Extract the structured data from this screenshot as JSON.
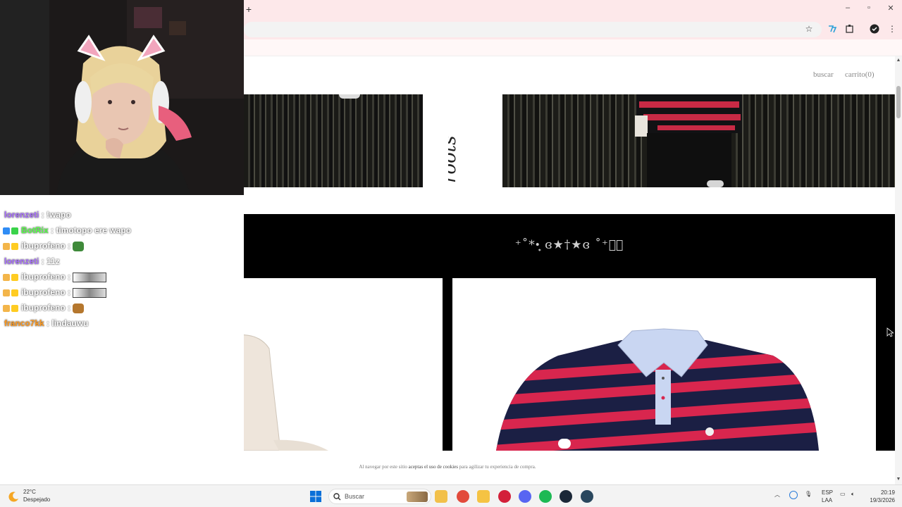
{
  "browser": {
    "new_tab_symbol": "+",
    "controls": {
      "minimize": "–",
      "restore": "▫",
      "close": "✕"
    }
  },
  "site": {
    "nav": {
      "search": "buscar",
      "cart": "carrito(0)"
    },
    "section_title": "⁺˚*•̩̩͙ ɞ★†★ɞ ˚⁺‧͙",
    "banner_logo_text": "roots",
    "cookie_notice": {
      "before": "Al navegar por este sitio ",
      "bold": "aceptas el uso de cookies",
      "after": " para agilizar tu experiencia de compra."
    },
    "products": [
      {
        "name": "hoodie",
        "color": "#efe6dc"
      },
      {
        "name": "striped-polo",
        "color": "#1b1f44",
        "stripe": "#d8264e",
        "collar": "#c9d6f2"
      }
    ]
  },
  "chat": {
    "messages": [
      {
        "user": "lorenzeti",
        "user_color": "#a970ff",
        "text": "!wapo",
        "badges": []
      },
      {
        "user": "BotRix",
        "user_color": "#5bff4d",
        "text": "timotopo ere wapo",
        "badges": [
          "#2f8cf5",
          "#3ad34a"
        ]
      },
      {
        "user": "ibuprofeno",
        "user_color": "#ffffff",
        "text": "",
        "badges": [
          "#f3b54a",
          "#ffcc22"
        ],
        "emote": "frog"
      },
      {
        "user": "lorenzeti",
        "user_color": "#a970ff",
        "text": "11z",
        "badges": []
      },
      {
        "user": "ibuprofeno",
        "user_color": "#ffffff",
        "text": "",
        "badges": [
          "#f3b54a",
          "#ffcc22"
        ],
        "thumb": true
      },
      {
        "user": "ibuprofeno",
        "user_color": "#ffffff",
        "text": "",
        "badges": [
          "#f3b54a",
          "#ffcc22"
        ],
        "thumb": true
      },
      {
        "user": "ibuprofeno",
        "user_color": "#ffffff",
        "text": "",
        "badges": [
          "#f3b54a",
          "#ffcc22"
        ],
        "emote": "dog"
      },
      {
        "user": "franco7kk",
        "user_color": "#ff9a1f",
        "text": "lindauwu",
        "badges": []
      }
    ]
  },
  "taskbar": {
    "weather_temp": "22°C",
    "weather_desc": "Despejado",
    "search_placeholder": "Buscar",
    "lang_top": "ESP",
    "lang_bottom": "LAA",
    "time": "20:19",
    "date": "19/3/2026",
    "apps": [
      {
        "name": "file-explorer-icon",
        "color": "#f2c04a"
      },
      {
        "name": "chrome-icon",
        "color": "#e24a3b"
      },
      {
        "name": "folder-icon",
        "color": "#f5c343"
      },
      {
        "name": "app-red-icon",
        "color": "#d3203a"
      },
      {
        "name": "discord-icon",
        "color": "#5865f2"
      },
      {
        "name": "spotify-icon",
        "color": "#1db954"
      },
      {
        "name": "steam-icon",
        "color": "#1b2838"
      },
      {
        "name": "steam-alt-icon",
        "color": "#2a475e"
      }
    ]
  }
}
